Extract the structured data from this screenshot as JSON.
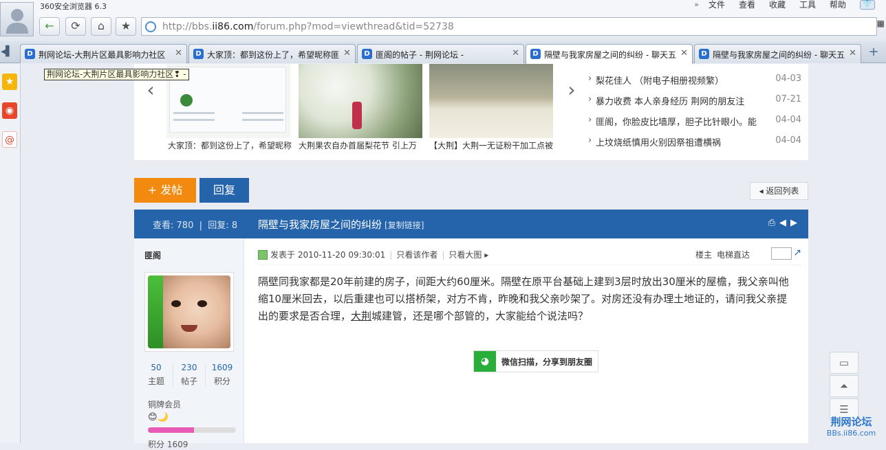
{
  "browser": {
    "app_title": "360安全浏览器 6.3",
    "menu": [
      "文件",
      "查看",
      "收藏",
      "工具",
      "帮助"
    ],
    "menu_chevron": "»",
    "url_prefix": "http://bbs.",
    "url_domain": "ii86.com",
    "url_path": "/forum.php?mod=viewthread&tid=52738",
    "tabs": [
      {
        "label": "荆网论坛-大荆片区最具影响力社区",
        "active": false
      },
      {
        "label": "大家顶：都到这份上了，希望昵称匪",
        "active": false
      },
      {
        "label": "匪阁的帖子 - 荆网论坛 -",
        "active": false
      },
      {
        "label": "隔壁与我家房屋之间的纠纷 - 聊天五",
        "active": true
      },
      {
        "label": "隔壁与我家房屋之间的纠纷 - 聊天五",
        "active": false
      }
    ],
    "new_tab": "+",
    "tooltip": "荆网论坛-大荆片区最具影响力社区❢ -"
  },
  "slider": {
    "captions": [
      "大家顶：都到这份上了，希望昵称",
      "大荆果农自办首届梨花节 引上万",
      "【大荆】大荆一无证粉干加工点被"
    ]
  },
  "news": [
    {
      "title": "梨花佳人 （附电子相册视频繁）",
      "date": "04-03"
    },
    {
      "title": "暴力收费 本人亲身经历 荆网的朋友注",
      "date": "07-21"
    },
    {
      "title": "匪阁，你脸皮比墙厚，胆子比针眼小。能",
      "date": "04-04"
    },
    {
      "title": "上坟烧纸慎用火别因祭祖遭横祸",
      "date": "04-04"
    }
  ],
  "actions": {
    "post": "+ 发帖",
    "reply": "回复",
    "back_list": "返回列表"
  },
  "thread": {
    "views_label": "查看:",
    "views": "780",
    "replies_label": "回复:",
    "replies": "8",
    "title": "隔壁与我家房屋之间的纠纷",
    "copy_link": "[复制链接]"
  },
  "author": {
    "name": "匪阁",
    "stats": [
      {
        "value": "50",
        "label": "主题"
      },
      {
        "value": "230",
        "label": "帖子"
      },
      {
        "value": "1609",
        "label": "积分"
      }
    ],
    "rank": "铜牌会员",
    "rank_icons": "😊🌙",
    "rank_progress": 0.52,
    "score_partial": "积分 1609"
  },
  "post": {
    "posted": "发表于 2010-11-20 09:30:01",
    "only_author": "只看该作者",
    "big_image": "只看大图",
    "floor": "楼主",
    "jump_label": "电梯直达",
    "body_before": "隔壁同我家都是20年前建的房子，间距大约60厘米。隔壁在原平台基础上建到3层时放出30厘米的屋檐，我父亲叫他缩10厘米回去，以后重建也可以搭桥架，对方不肯，昨晚和我父亲吵架了。对房还没有办理土地证的，请问我父亲提出的要求是否合理，",
    "body_link": "大荆",
    "body_after": "城建管，还是哪个部管的，大家能给个说法吗？",
    "wechat": "微信扫描，分享到朋友圈"
  },
  "watermark": {
    "line1": "荆网论坛",
    "line2": "BBs.ii86.com"
  },
  "colors": {
    "brand_blue": "#2564ab",
    "post_orange": "#f28a10",
    "rank_pink": "#e85bb4",
    "wechat_green": "#2aae3a"
  }
}
